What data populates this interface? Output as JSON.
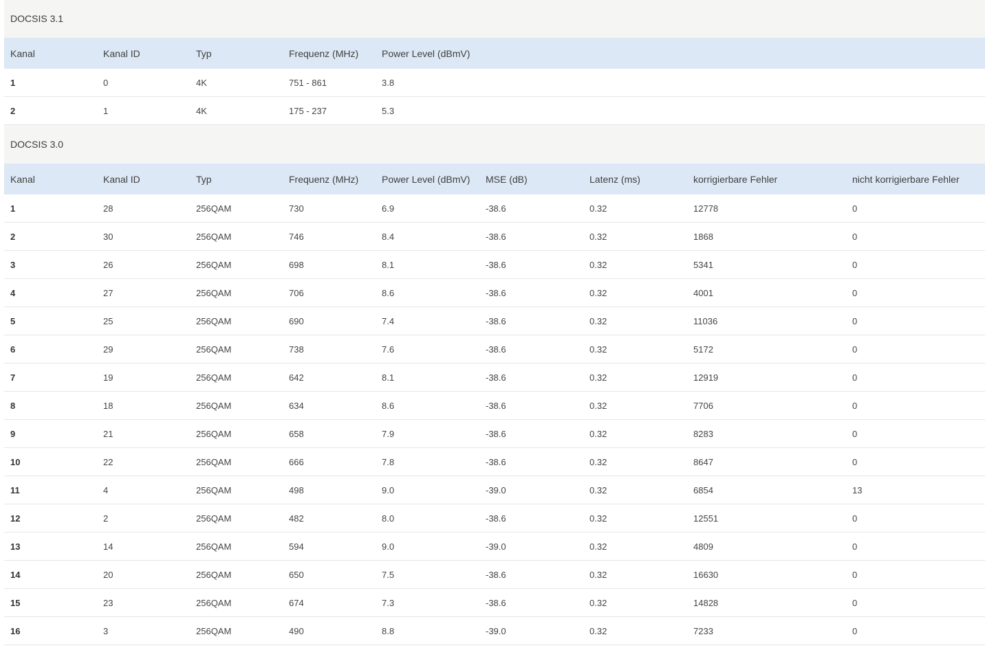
{
  "docsis31": {
    "title": "DOCSIS 3.1",
    "headers": [
      "Kanal",
      "Kanal ID",
      "Typ",
      "Frequenz (MHz)",
      "Power Level (dBmV)"
    ],
    "rows": [
      [
        "1",
        "0",
        "4K",
        "751 - 861",
        "3.8"
      ],
      [
        "2",
        "1",
        "4K",
        "175 - 237",
        "5.3"
      ]
    ]
  },
  "docsis30": {
    "title": "DOCSIS 3.0",
    "headers": [
      "Kanal",
      "Kanal ID",
      "Typ",
      "Frequenz (MHz)",
      "Power Level (dBmV)",
      "MSE (dB)",
      "Latenz (ms)",
      "korrigierbare Fehler",
      "nicht korrigierbare Fehler"
    ],
    "rows": [
      [
        "1",
        "28",
        "256QAM",
        "730",
        "6.9",
        "-38.6",
        "0.32",
        "12778",
        "0"
      ],
      [
        "2",
        "30",
        "256QAM",
        "746",
        "8.4",
        "-38.6",
        "0.32",
        "1868",
        "0"
      ],
      [
        "3",
        "26",
        "256QAM",
        "698",
        "8.1",
        "-38.6",
        "0.32",
        "5341",
        "0"
      ],
      [
        "4",
        "27",
        "256QAM",
        "706",
        "8.6",
        "-38.6",
        "0.32",
        "4001",
        "0"
      ],
      [
        "5",
        "25",
        "256QAM",
        "690",
        "7.4",
        "-38.6",
        "0.32",
        "11036",
        "0"
      ],
      [
        "6",
        "29",
        "256QAM",
        "738",
        "7.6",
        "-38.6",
        "0.32",
        "5172",
        "0"
      ],
      [
        "7",
        "19",
        "256QAM",
        "642",
        "8.1",
        "-38.6",
        "0.32",
        "12919",
        "0"
      ],
      [
        "8",
        "18",
        "256QAM",
        "634",
        "8.6",
        "-38.6",
        "0.32",
        "7706",
        "0"
      ],
      [
        "9",
        "21",
        "256QAM",
        "658",
        "7.9",
        "-38.6",
        "0.32",
        "8283",
        "0"
      ],
      [
        "10",
        "22",
        "256QAM",
        "666",
        "7.8",
        "-38.6",
        "0.32",
        "8647",
        "0"
      ],
      [
        "11",
        "4",
        "256QAM",
        "498",
        "9.0",
        "-39.0",
        "0.32",
        "6854",
        "13"
      ],
      [
        "12",
        "2",
        "256QAM",
        "482",
        "8.0",
        "-38.6",
        "0.32",
        "12551",
        "0"
      ],
      [
        "13",
        "14",
        "256QAM",
        "594",
        "9.0",
        "-39.0",
        "0.32",
        "4809",
        "0"
      ],
      [
        "14",
        "20",
        "256QAM",
        "650",
        "7.5",
        "-38.6",
        "0.32",
        "16630",
        "0"
      ],
      [
        "15",
        "23",
        "256QAM",
        "674",
        "7.3",
        "-38.6",
        "0.32",
        "14828",
        "0"
      ],
      [
        "16",
        "3",
        "256QAM",
        "490",
        "8.8",
        "-39.0",
        "0.32",
        "7233",
        "0"
      ]
    ]
  }
}
